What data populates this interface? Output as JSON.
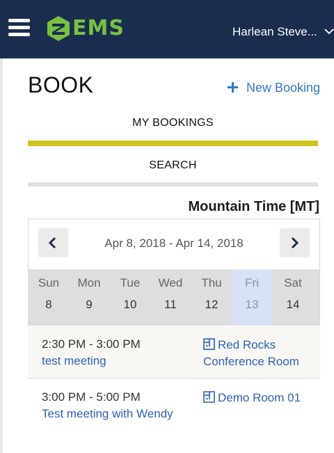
{
  "header": {
    "menu_icon": "hamburger-icon",
    "logo_text": "EMS",
    "logo_tm": "®",
    "logo_color": "#7ac143",
    "background_color": "#1a2d4e",
    "user_name": "Harlean Steve...",
    "user_chevron_icon": "chevron-down-icon"
  },
  "page": {
    "title": "BOOK",
    "new_booking_icon": "plus-icon",
    "new_booking_label": "New Booking",
    "accent_color": "#2f78c4"
  },
  "tabs": [
    {
      "label": "MY BOOKINGS",
      "active": true,
      "indicator_color": "#cfc31e"
    },
    {
      "label": "SEARCH",
      "active": false
    }
  ],
  "calendar": {
    "timezone": "Mountain Time [MT]",
    "date_range": "Apr 8, 2018 - Apr 14, 2018",
    "prev_icon": "chevron-left-icon",
    "next_icon": "chevron-right-icon",
    "days": [
      {
        "name": "Sun",
        "num": "8"
      },
      {
        "name": "Mon",
        "num": "9"
      },
      {
        "name": "Tue",
        "num": "10"
      },
      {
        "name": "Wed",
        "num": "11"
      },
      {
        "name": "Thu",
        "num": "12"
      },
      {
        "name": "Fri",
        "num": "13",
        "selected": true
      },
      {
        "name": "Sat",
        "num": "14"
      }
    ]
  },
  "bookings": [
    {
      "time": "2:30 PM - 3:00 PM",
      "name": "test meeting",
      "room": "Red Rocks Conference Room",
      "room_icon": "room-icon"
    },
    {
      "time": "3:00 PM - 5:00 PM",
      "name": "Test meeting with Wendy",
      "room": "Demo Room 01",
      "room_icon": "room-icon"
    }
  ]
}
